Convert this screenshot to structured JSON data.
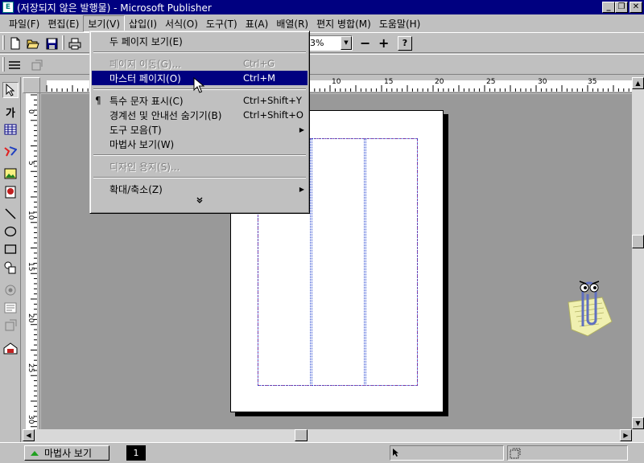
{
  "window": {
    "title": "(저장되지 않은 발행물) - Microsoft Publisher",
    "app_icon": "publisher-icon",
    "buttons": {
      "minimize": "_",
      "restore": "❐",
      "close": "✕"
    }
  },
  "menubar": {
    "items": [
      {
        "label": "파일(F)"
      },
      {
        "label": "편집(E)"
      },
      {
        "label": "보기(V)",
        "active": true
      },
      {
        "label": "삽입(I)"
      },
      {
        "label": "서식(O)"
      },
      {
        "label": "도구(T)"
      },
      {
        "label": "표(A)"
      },
      {
        "label": "배열(R)"
      },
      {
        "label": "편지 병합(M)"
      },
      {
        "label": "도움말(H)"
      }
    ]
  },
  "toolbar": {
    "zoom_value": "33%",
    "zoom_minus": "−",
    "zoom_plus": "+",
    "help": "?"
  },
  "view_menu": {
    "items": [
      {
        "label": "두 페이지 보기(E)",
        "shortcut": "",
        "disabled": false
      },
      {
        "separator": true
      },
      {
        "label": "페이지 이동(G)...",
        "shortcut": "Ctrl+G",
        "disabled": true
      },
      {
        "label": "마스터 페이지(O)",
        "shortcut": "Ctrl+M",
        "highlighted": true
      },
      {
        "separator": true
      },
      {
        "label": "특수 문자 표시(C)",
        "shortcut": "Ctrl+Shift+Y",
        "check": "¶"
      },
      {
        "label": "경계선 및 안내선 숨기기(B)",
        "shortcut": "Ctrl+Shift+O"
      },
      {
        "label": "도구 모음(T)",
        "submenu": true
      },
      {
        "label": "마법사 보기(W)"
      },
      {
        "separator": true
      },
      {
        "label": "디자인 용지(S)...",
        "disabled": true
      },
      {
        "separator": true
      },
      {
        "label": "확대/축소(Z)",
        "submenu": true
      }
    ],
    "more_glyph": "»"
  },
  "ruler": {
    "top_labels": [
      "10",
      "15",
      "20",
      "25",
      "30",
      "35"
    ],
    "left_labels": [
      "0",
      "5",
      "10",
      "15",
      "20",
      "25",
      "30"
    ]
  },
  "statusbar": {
    "wizard_button": "마법사 보기",
    "page_number": "1"
  },
  "colors": {
    "titlebar": "#000080",
    "chrome": "#c0c0c0",
    "workspace": "#999999",
    "margin_guide": "#d04080",
    "column_guide": "#2040d0"
  }
}
